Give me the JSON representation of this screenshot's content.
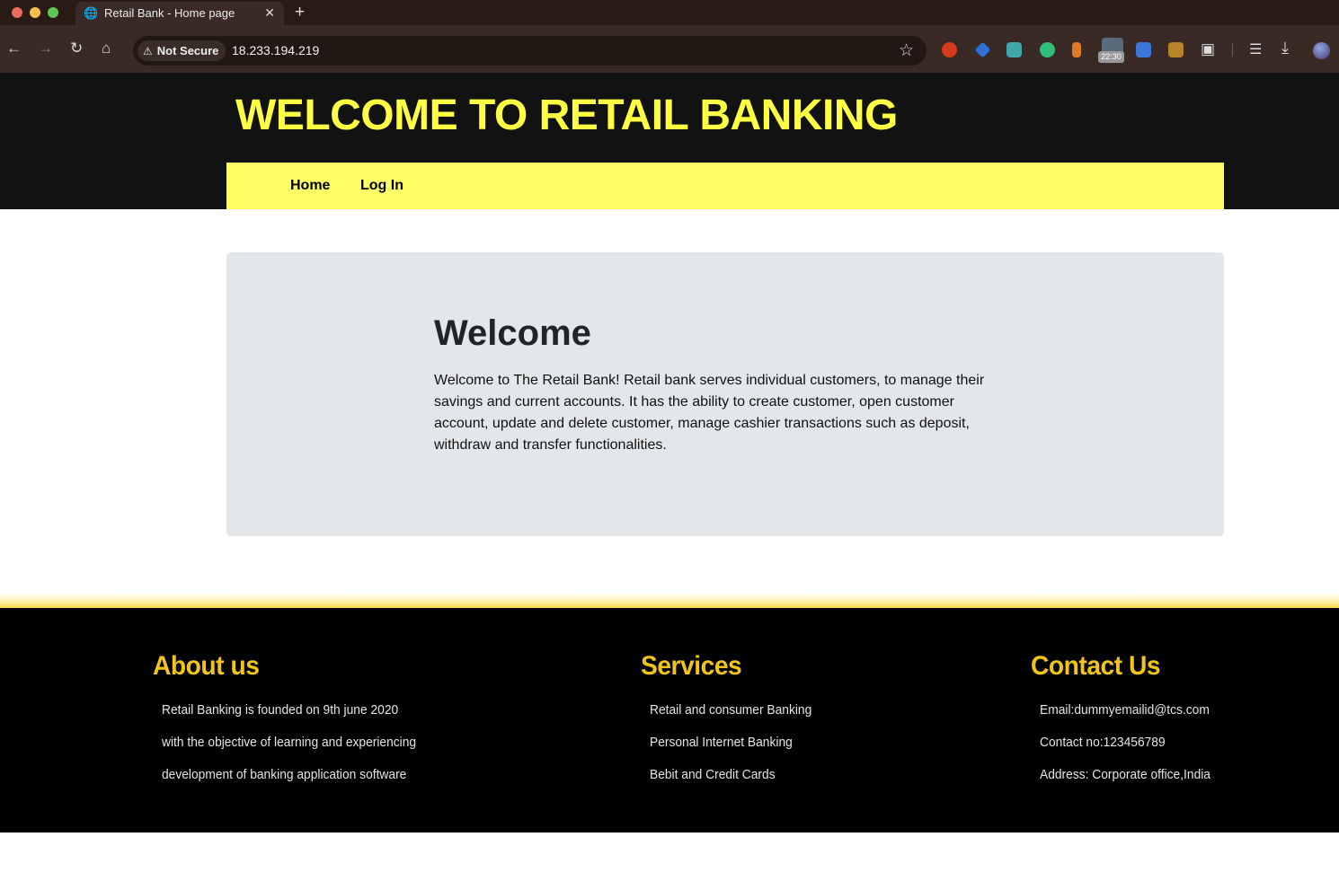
{
  "browser": {
    "tab_title": "Retail Bank - Home page",
    "security_label": "Not Secure",
    "url": "18.233.194.219",
    "extension_badge": "22:30"
  },
  "site": {
    "title": "WELCOME TO RETAIL BANKING",
    "nav": [
      {
        "label": "Home"
      },
      {
        "label": "Log In"
      }
    ],
    "accent_color": "#ffff66"
  },
  "main": {
    "heading": "Welcome",
    "body": "Welcome to The Retail Bank! Retail bank serves individual customers, to manage their savings and current accounts. It has the ability to create customer, open customer account, update and delete customer, manage cashier transactions such as deposit, withdraw and transfer functionalities."
  },
  "footer": {
    "about": {
      "heading": "About us",
      "lines": [
        "Retail Banking is founded on 9th june 2020",
        "with the objective of learning and experiencing",
        "development of banking application software"
      ]
    },
    "services": {
      "heading": "Services",
      "lines": [
        "Retail and consumer Banking",
        "Personal Internet Banking",
        "Bebit and Credit Cards"
      ]
    },
    "contact": {
      "heading": "Contact Us",
      "lines": [
        "Email:dummyemailid@tcs.com",
        "Contact no:123456789",
        "Address: Corporate office,India"
      ]
    },
    "heading_color": "#f0c419"
  }
}
